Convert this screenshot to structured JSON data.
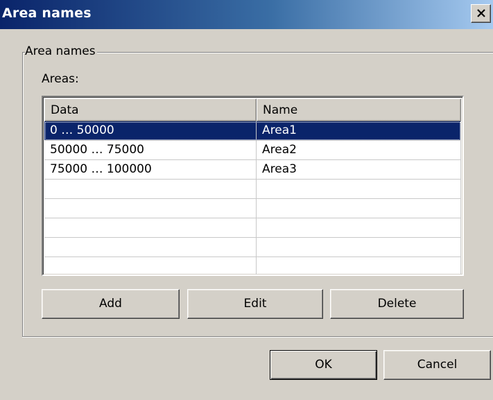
{
  "window": {
    "title": "Area names"
  },
  "group": {
    "legend": "Area names",
    "areas_label": "Areas:"
  },
  "list": {
    "columns": [
      "Data",
      "Name"
    ],
    "rows": [
      {
        "data": "0 … 50000",
        "name": "Area1",
        "selected": true
      },
      {
        "data": "50000 … 75000",
        "name": "Area2",
        "selected": false
      },
      {
        "data": "75000 … 100000",
        "name": "Area3",
        "selected": false
      },
      {
        "data": "",
        "name": "",
        "selected": false
      },
      {
        "data": "",
        "name": "",
        "selected": false
      },
      {
        "data": "",
        "name": "",
        "selected": false
      },
      {
        "data": "",
        "name": "",
        "selected": false
      },
      {
        "data": "",
        "name": "",
        "selected": false
      }
    ]
  },
  "buttons": {
    "add": "Add",
    "edit": "Edit",
    "delete": "Delete",
    "ok": "OK",
    "cancel": "Cancel"
  },
  "icons": {
    "close": "close-icon"
  },
  "colors": {
    "title_start": "#0a246a",
    "title_end": "#a6caf0",
    "selection": "#0a246a",
    "face": "#d4d0c8"
  }
}
